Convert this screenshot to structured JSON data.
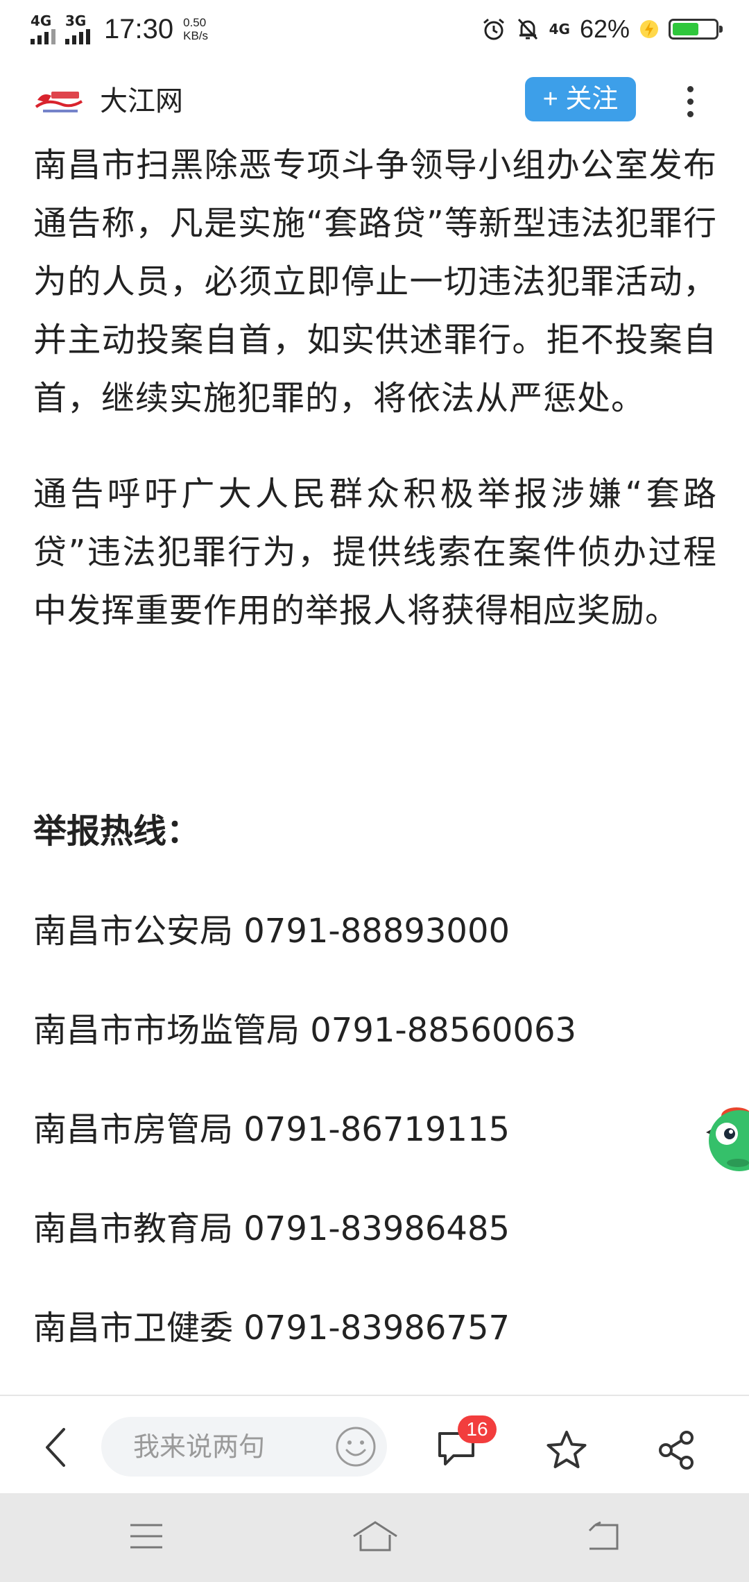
{
  "status_bar": {
    "network1": "4G",
    "network2": "3G",
    "time": "17:30",
    "speed_value": "0.50",
    "speed_unit": "KB/s",
    "network3": "4G",
    "battery_percent": "62%",
    "battery_level": 0.62,
    "battery_color": "#2fc73c"
  },
  "header": {
    "site_name": "大江网",
    "follow_label": "+ 关注",
    "follow_color": "#3d9fe9",
    "logo_icon": "dajiang-logo"
  },
  "article": {
    "paragraphs": [
      "南昌市扫黑除恶专项斗争领导小组办公室发布通告称，凡是实施“套路贷”等新型违法犯罪行为的人员，必须立即停止一切违法犯罪活动，并主动投案自首，如实供述罪行。拒不投案自首，继续实施犯罪的，将依法从严惩处。",
      "通告呼吁广大人民群众积极举报涉嫌“套路贷”违法犯罪行为，提供线索在案件侦办过程中发挥重要作用的举报人将获得相应奖励。"
    ],
    "hotline_title": "举报热线：",
    "hotlines": [
      "南昌市公安局 0791-88893000",
      "南昌市市场监管局 0791-88560063",
      "南昌市房管局 0791-86719115",
      "南昌市教育局 0791-83986485",
      "南昌市卫健委 0791-83986757"
    ]
  },
  "action_bar": {
    "comment_placeholder": "我来说两句",
    "comment_count": "16",
    "icons": [
      "back-icon",
      "emoji-icon",
      "comment-icon",
      "star-icon",
      "share-icon"
    ]
  },
  "nav_bar": {
    "icons": [
      "menu-icon",
      "home-icon",
      "back-icon"
    ]
  }
}
